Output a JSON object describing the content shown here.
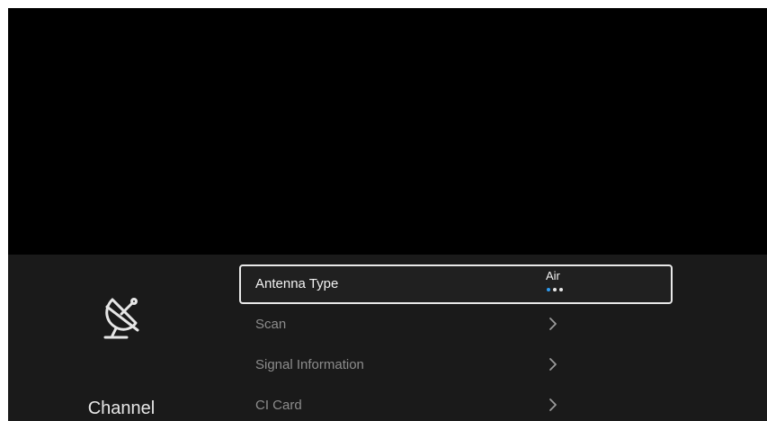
{
  "category": {
    "label": "Channel",
    "icon": "satellite-dish-icon"
  },
  "menu": {
    "items": [
      {
        "label": "Antenna Type",
        "value": "Air",
        "option_count": 3,
        "selected_option_index": 0,
        "focused": true
      },
      {
        "label": "Scan",
        "icon": "chevron-right-icon"
      },
      {
        "label": "Signal Information",
        "icon": "chevron-right-icon"
      },
      {
        "label": "CI Card",
        "icon": "chevron-right-icon"
      }
    ]
  },
  "colors": {
    "background": "#000000",
    "panel": "#1a1a1a",
    "focus_border": "#e8e8e8",
    "active_dot": "#2e9bf0"
  }
}
